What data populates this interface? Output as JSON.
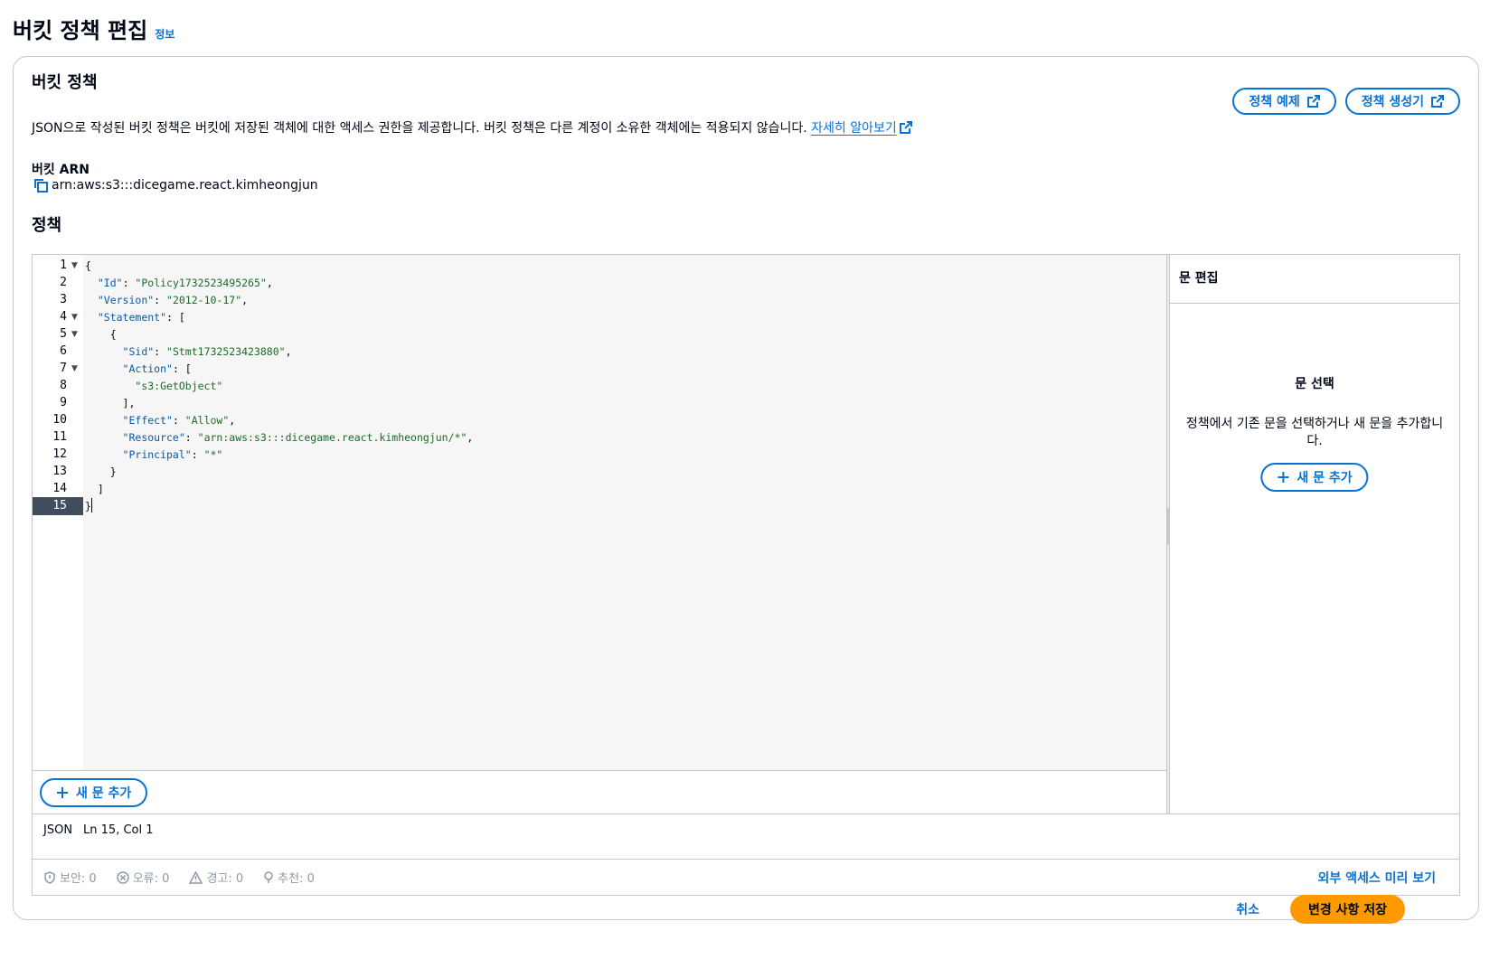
{
  "page": {
    "title": "버킷 정책 편집",
    "info_link": "정보"
  },
  "section": {
    "title": "버킷 정책",
    "description": "JSON으로 작성된 버킷 정책은 버킷에 저장된 객체에 대한 액세스 권한을 제공합니다. 버킷 정책은 다른 계정이 소유한 객체에는 적용되지 않습니다.",
    "learn_more": "자세히 알아보기",
    "policy_examples": "정책 예제",
    "policy_generator": "정책 생성기"
  },
  "arn": {
    "label": "버킷 ARN",
    "value": "arn:aws:s3:::dicegame.react.kimheongjun"
  },
  "policy": {
    "label": "정책"
  },
  "editor": {
    "lines": [
      {
        "no": "1",
        "text": "{"
      },
      {
        "no": "2",
        "text": "  \"Id\": \"Policy1732523495265\","
      },
      {
        "no": "3",
        "text": "  \"Version\": \"2012-10-17\","
      },
      {
        "no": "4",
        "text": "  \"Statement\": ["
      },
      {
        "no": "5",
        "text": "    {"
      },
      {
        "no": "6",
        "text": "      \"Sid\": \"Stmt1732523423880\","
      },
      {
        "no": "7",
        "text": "      \"Action\": ["
      },
      {
        "no": "8",
        "text": "        \"s3:GetObject\""
      },
      {
        "no": "9",
        "text": "      ],"
      },
      {
        "no": "10",
        "text": "      \"Effect\": \"Allow\","
      },
      {
        "no": "11",
        "text": "      \"Resource\": \"arn:aws:s3:::dicegame.react.kimheongjun/*\","
      },
      {
        "no": "12",
        "text": "      \"Principal\": \"*\""
      },
      {
        "no": "13",
        "text": "    }"
      },
      {
        "no": "14",
        "text": "  ]"
      },
      {
        "no": "15",
        "text": "}"
      }
    ],
    "fold_lines": [
      "1",
      "4",
      "5",
      "7"
    ],
    "active_line": "15",
    "add_statement": "새 문 추가"
  },
  "side_panel": {
    "title": "문 편집",
    "empty_title": "문 선택",
    "empty_desc": "정책에서 기존 문을 선택하거나 새 문을 추가합니다.",
    "add_statement": "새 문 추가"
  },
  "status": {
    "language": "JSON",
    "position": "Ln 15, Col 1",
    "security": "보안: 0",
    "errors": "오류: 0",
    "warnings": "경고: 0",
    "suggestions": "추천: 0",
    "preview": "외부 액세스 미리 보기"
  },
  "footer": {
    "cancel": "취소",
    "save": "변경 사항 저장"
  },
  "colors": {
    "accent": "#0972d3",
    "primary": "#ff9900"
  },
  "icons": [
    "external-link-icon",
    "copy-icon",
    "plus-icon",
    "shield-icon",
    "error-icon",
    "warning-icon",
    "lightbulb-icon",
    "fold-arrow-icon"
  ]
}
